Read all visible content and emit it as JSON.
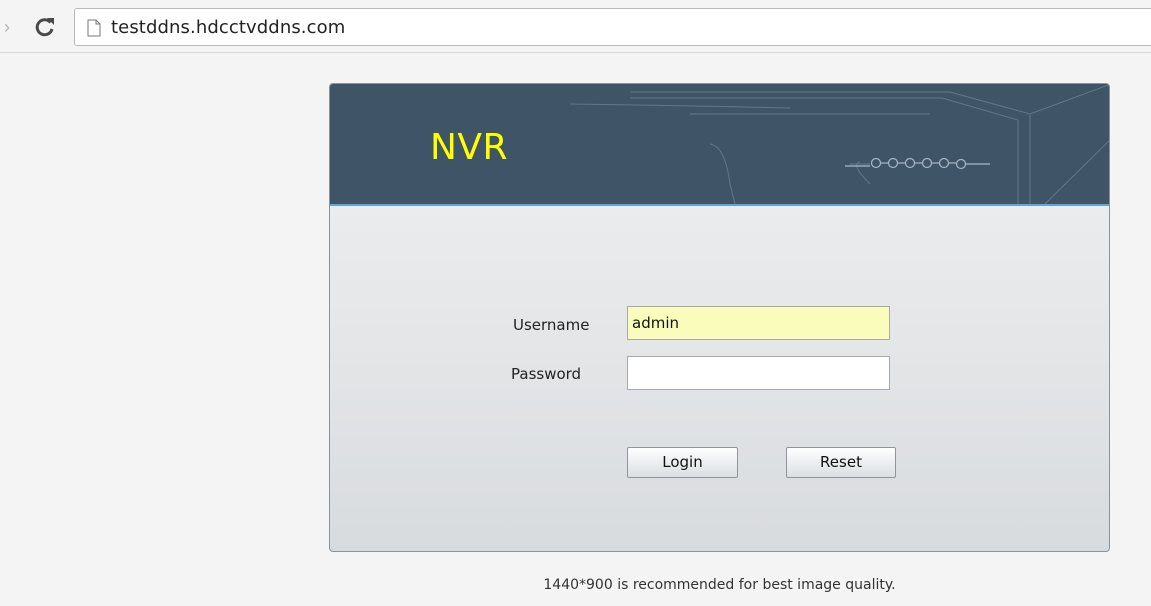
{
  "browser": {
    "url": "testddns.hdcctvddns.com",
    "forward_icon": "forward-arrow-icon",
    "reload_icon": "reload-icon",
    "page_icon": "page-icon"
  },
  "login": {
    "logo": "NVR",
    "username_label": "Username",
    "username_value": "admin",
    "password_label": "Password",
    "password_value": "",
    "login_label": "Login",
    "reset_label": "Reset"
  },
  "footer": {
    "note": "1440*900 is recommended for best image quality."
  },
  "colors": {
    "banner": "#3f5467",
    "logo": "#ffff00",
    "autofill": "#fafcbc"
  }
}
